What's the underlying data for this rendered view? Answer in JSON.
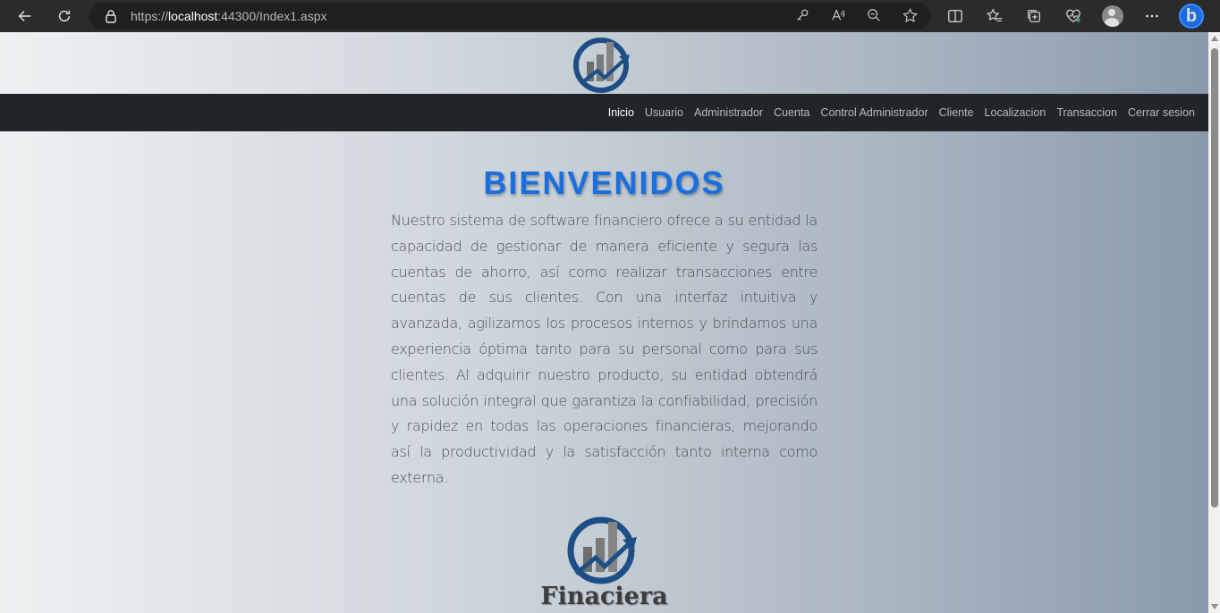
{
  "browser": {
    "url_prefix": "https://",
    "url_host": "localhost",
    "url_rest": ":44300/Index1.aspx"
  },
  "navbar": {
    "items": [
      {
        "label": "Inicio",
        "active": true
      },
      {
        "label": "Usuario"
      },
      {
        "label": "Administrador"
      },
      {
        "label": "Cuenta"
      },
      {
        "label": "Control Administrador"
      },
      {
        "label": "Cliente"
      },
      {
        "label": "Localizacion"
      },
      {
        "label": "Transaccion"
      },
      {
        "label": "Cerrar sesion"
      }
    ]
  },
  "main": {
    "title": "BIENVENIDOS",
    "paragraph": "Nuestro sistema de software financiero ofrece a su entidad la capacidad de gestionar de manera eficiente y segura las cuentas de ahorro, así como realizar transacciones entre cuentas de sus clientes. Con una interfaz intuitiva y avanzada, agilizamos los procesos internos y brindamos una experiencia óptima tanto para su personal como para sus clientes. Al adquirir nuestro producto, su entidad obtendrá una solución integral que garantiza la confiabilidad, precisión y rapidez en todas las operaciones financieras, mejorando así la productividad y la satisfacción tanto interna como externa.",
    "brand_name": "Finaciera"
  },
  "colors": {
    "accent": "#1a6fe0",
    "navbar_bg": "#212529",
    "logo_blue": "#1d4f86"
  },
  "icons": [
    "back-icon",
    "refresh-icon",
    "lock-icon",
    "key-icon",
    "read-aloud-icon",
    "zoom-out-icon",
    "favorite-star-icon",
    "split-screen-icon",
    "favorites-icon",
    "collections-icon",
    "health-icon",
    "profile-avatar",
    "more-icon",
    "bing-icon",
    "finance-logo"
  ]
}
